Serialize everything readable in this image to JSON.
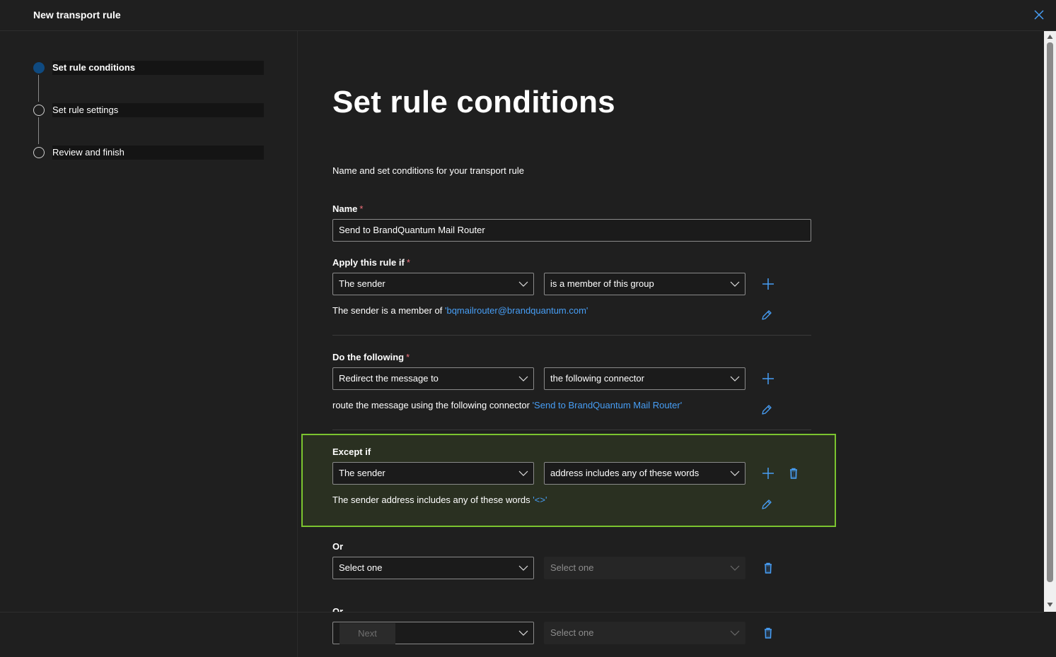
{
  "header": {
    "title": "New transport rule",
    "close_icon": "close-icon"
  },
  "steps": [
    {
      "label": "Set rule conditions",
      "active": true
    },
    {
      "label": "Set rule settings",
      "active": false
    },
    {
      "label": "Review and finish",
      "active": false
    }
  ],
  "main": {
    "title": "Set rule conditions",
    "subtitle": "Name and set conditions for your transport rule",
    "name": {
      "label": "Name",
      "required": "*",
      "value": "Send to BrandQuantum Mail Router"
    },
    "apply": {
      "label": "Apply this rule if",
      "required": "*",
      "dropdown1": "The sender",
      "dropdown2": "is a member of this group",
      "summary_text": "The sender is a member of",
      "summary_link": "'bqmailrouter@brandquantum.com'"
    },
    "do": {
      "label": "Do the following",
      "required": "*",
      "dropdown1": "Redirect the message to",
      "dropdown2": "the following connector",
      "summary_text": "route the message using the following connector",
      "summary_link": "'Send to BrandQuantum Mail Router'"
    },
    "except": {
      "label": "Except if",
      "dropdown1": "The sender",
      "dropdown2": "address includes any of these words",
      "summary_text": "The sender address includes any of these words",
      "summary_link": "'<>'"
    },
    "or1": {
      "label": "Or",
      "dropdown1": "Select one",
      "dropdown2": "Select one"
    },
    "or2": {
      "label": "Or",
      "dropdown2": "Select one"
    }
  },
  "footer": {
    "next_label": "Next"
  },
  "colors": {
    "accent": "#479ef5",
    "highlight_border": "#7bc42f",
    "required": "#f1707b",
    "active_step": "#0f4a80"
  }
}
